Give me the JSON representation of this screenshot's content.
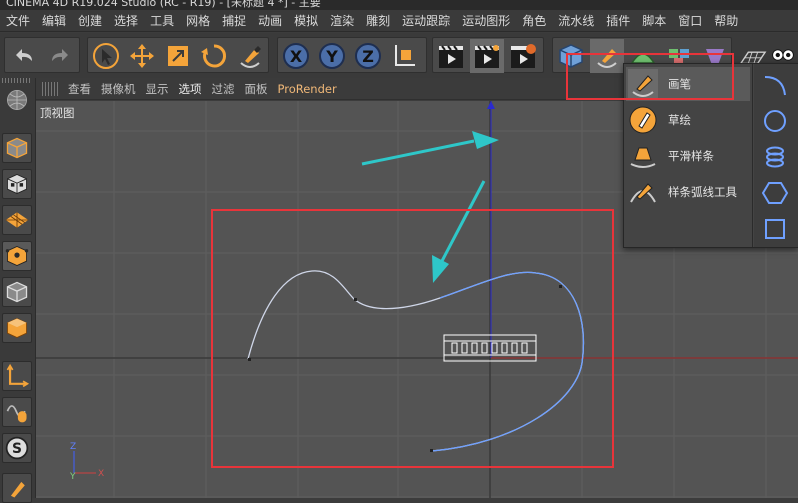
{
  "window": {
    "title": "CINEMA 4D R19.024 Studio (RC - R19) - [未标题 4 *] - 主要"
  },
  "menu": [
    "文件",
    "编辑",
    "创建",
    "选择",
    "工具",
    "网格",
    "捕捉",
    "动画",
    "模拟",
    "渲染",
    "雕刻",
    "运动跟踪",
    "运动图形",
    "角色",
    "流水线",
    "插件",
    "脚本",
    "窗口",
    "帮助"
  ],
  "toolbar": {
    "undo_icon": "undo-icon",
    "redo_icon": "redo-icon",
    "axis_x": "X",
    "axis_y": "Y",
    "axis_z": "Z"
  },
  "viewport_tabs": [
    "查看",
    "摄像机",
    "显示",
    "选项",
    "过滤",
    "面板",
    "ProRender"
  ],
  "viewport": {
    "label": "顶视图",
    "axis_z": "Z",
    "axis_y": "Y",
    "axis_x": "X"
  },
  "spline_menu": {
    "items": [
      {
        "label": "画笔",
        "icon": "pen-icon"
      },
      {
        "label": "草绘",
        "icon": "sketch-icon"
      },
      {
        "label": "平滑样条",
        "icon": "smooth-spline-icon"
      },
      {
        "label": "样条弧线工具",
        "icon": "spline-arc-icon"
      }
    ],
    "shapes": [
      "arc-icon",
      "circle-icon",
      "helix-icon",
      "hexagon-icon",
      "rectangle-icon"
    ]
  },
  "colors": {
    "annotation_red": "#e8343a",
    "arrow_cyan": "#2ec7c9",
    "accent_orange": "#f4a43a"
  }
}
